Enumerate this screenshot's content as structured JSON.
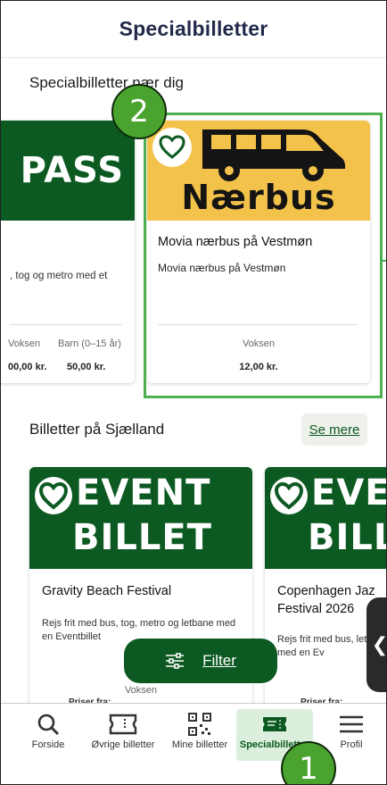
{
  "header": {
    "title": "Specialbilletter"
  },
  "section_near": {
    "title": "Specialbilletter nær dig"
  },
  "pass_card": {
    "brand": "PASS",
    "description": ", tog og metro med et",
    "label_adult": "Voksen",
    "label_child": "Barn (0–15 år)",
    "price_adult": "00,00 kr.",
    "price_child": "50,00 kr."
  },
  "bus_card": {
    "brand": "Nærbus",
    "title": "Movia nærbus på Vestmøn",
    "subtitle": "Movia nærbus på Vestmøn",
    "label": "Voksen",
    "price": "12,00 kr."
  },
  "section_zealand": {
    "title": "Billetter på Sjælland",
    "more": "Se mere"
  },
  "event_card1": {
    "brand_line1": "EVENT",
    "brand_line2": "BILLET",
    "title": "Gravity Beach Festival",
    "subtitle": "Rejs frit med bus, tog, metro og letbane med en Eventbillet",
    "label": "Voksen",
    "price_from": "Priser fra:"
  },
  "event_card2": {
    "brand_line1": "EVE",
    "brand_line2": "BILL",
    "title": "Copenhagen Jaz Festival 2026",
    "subtitle": "Rejs frit med bus, letbane med en Ev",
    "price_from": "Priser fra:"
  },
  "filter": {
    "label": "Filter"
  },
  "nav": {
    "items": [
      {
        "label": "Forside",
        "icon": "search-icon"
      },
      {
        "label": "Øvrige billetter",
        "icon": "ticket-icon"
      },
      {
        "label": "Mine billetter",
        "icon": "qr-code-icon"
      },
      {
        "label": "Specialbilletter",
        "icon": "special-ticket-icon"
      },
      {
        "label": "Profil",
        "icon": "menu-icon"
      }
    ]
  },
  "annotations": {
    "badge_1": "1",
    "badge_2": "2"
  },
  "colors": {
    "primary": "#0c5a22",
    "bus_yellow": "#f2c24b",
    "annotation": "#4caf50"
  }
}
